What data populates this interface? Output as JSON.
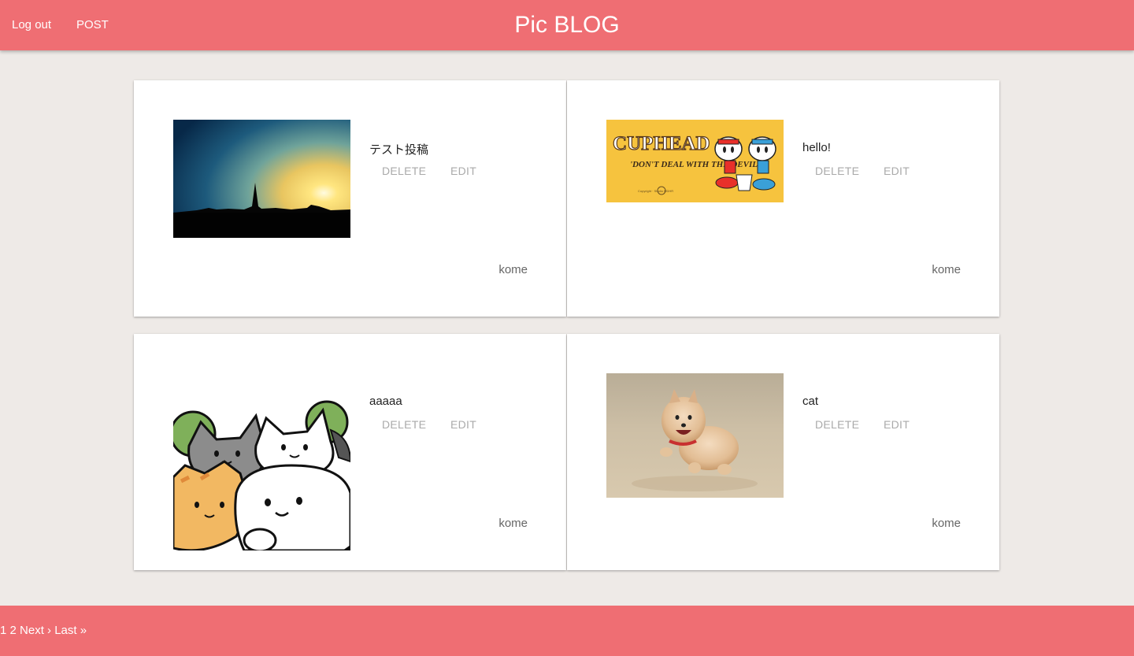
{
  "header": {
    "brand": "Pic BLOG",
    "logout_label": "Log out",
    "post_label": "POST",
    "color": "#ef6e73"
  },
  "posts": [
    {
      "title": "テスト投稿",
      "image": "sunset skyline photo",
      "author": "kome",
      "delete_label": "DELETE",
      "edit_label": "EDIT"
    },
    {
      "title": "hello!",
      "image": "cuphead banner",
      "author": "kome",
      "delete_label": "DELETE",
      "edit_label": "EDIT"
    },
    {
      "title": "aaaaa",
      "image": "cartoon cats illustration",
      "author": "kome",
      "delete_label": "DELETE",
      "edit_label": "EDIT"
    },
    {
      "title": "cat",
      "image": "running pomeranian photo",
      "author": "kome",
      "delete_label": "DELETE",
      "edit_label": "EDIT"
    }
  ],
  "cuphead_banner": {
    "logo": "CUPHEAD",
    "tagline": "'DON'T DEAL WITH THE DEVIL'"
  },
  "pagination": {
    "page1": "1",
    "page2": "2",
    "next": "Next ›",
    "last": "Last »"
  }
}
